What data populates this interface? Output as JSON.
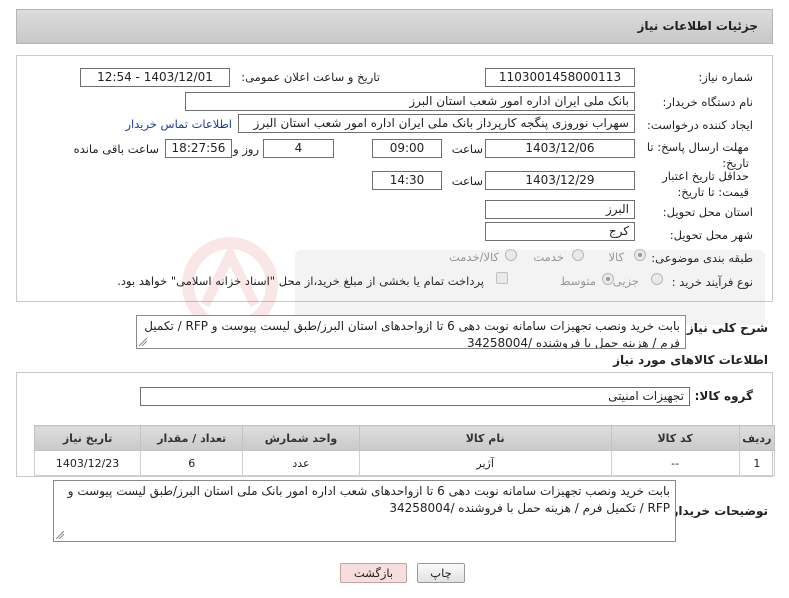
{
  "header": {
    "title": "جزئیات اطلاعات نیاز"
  },
  "form": {
    "need_number_label": "شماره نیاز:",
    "need_number": "1103001458000113",
    "announce_label": "تاریخ و ساعت اعلان عمومی:",
    "announce_value": "1403/12/01 - 12:54",
    "buyer_org_label": "نام دستگاه خریدار:",
    "buyer_org": "بانک ملی ایران اداره امور شعب استان البرز",
    "creator_label": "ایجاد کننده درخواست:",
    "creator": "سهراب نوروزی پنگجه کارپرداز بانک ملی ایران اداره امور شعب استان البرز",
    "contact_link": "اطلاعات تماس خریدار",
    "reply_deadline_label": "مهلت ارسال پاسخ: تا تاریخ:",
    "reply_date": "1403/12/06",
    "time_label": "ساعت",
    "reply_time": "09:00",
    "days_value": "4",
    "days_label": "روز و",
    "remaining_time": "18:27:56",
    "remaining_label": "ساعت باقی مانده",
    "price_validity_label": "حداقل تاریخ اعتبار قیمت: تا تاریخ:",
    "price_date": "1403/12/29",
    "price_time": "14:30",
    "province_label": "استان محل تحویل:",
    "province": "البرز",
    "city_label": "شهر محل تحویل:",
    "city": "کرج",
    "category_label": "طبقه بندی موضوعی:",
    "category_options": [
      "کالا",
      "خدمت",
      "کالا/خدمت"
    ],
    "process_label": "نوع فرآیند خرید :",
    "process_options": [
      "جزیی",
      "متوسط"
    ],
    "payment_note": "پرداخت تمام یا بخشی از مبلغ خرید،از محل \"اسناد خزانه اسلامی\" خواهد بود."
  },
  "summary": {
    "label": "شرح کلی نیاز:",
    "text_line1": "بابت خرید ونصب تجهیزات سامانه نوبت دهی 6 تا ازواحدهای استان البرز/طبق لیست پیوست و RFP / تکمیل",
    "text_line2": "فرم / هزینه حمل با فروشنده /34258004"
  },
  "goods": {
    "section_title": "اطلاعات کالاهای مورد نیاز",
    "group_label": "گروه کالا:",
    "group_value": "تجهیزات امنیتی",
    "columns": [
      "ردیف",
      "کد کالا",
      "نام کالا",
      "واحد شمارش",
      "تعداد / مقدار",
      "تاریخ نیاز"
    ],
    "rows": [
      {
        "row": "1",
        "code": "--",
        "name": "آژیر",
        "unit": "عدد",
        "qty": "6",
        "date": "1403/12/23"
      }
    ]
  },
  "buyer_notes": {
    "label": "توضیحات خریدار:",
    "text_line1": "بابت خرید ونصب تجهیزات سامانه نوبت دهی 6 تا ازواحدهای شعب اداره امور بانک ملی استان البرز/طبق لیست پیوست و",
    "text_line2": "RFP / تکمیل فرم / هزینه حمل با فروشنده /34258004"
  },
  "buttons": {
    "print": "چاپ",
    "back": "بازگشت"
  },
  "colors": {
    "link": "#1a3fa6",
    "back_button_bg": "#f7dede",
    "header_bg": "#d2d2d2"
  }
}
